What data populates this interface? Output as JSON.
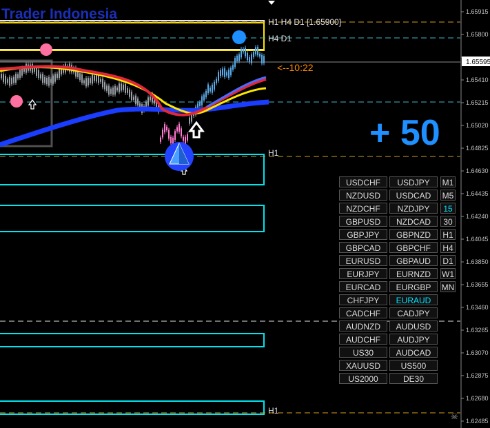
{
  "watermark": "Trader Indonesia",
  "hline_labels": {
    "h1_h4_d1": "H1 H4 D1  [1.65900]",
    "h4_d1": "H4 D1",
    "h1_upper": "H1",
    "h1_lower": "H1"
  },
  "countdown": "<--10:22",
  "profit_text": "+ 50",
  "current_price": "1.65595",
  "price_axis": [
    "1.65915",
    "1.65800",
    "1.65595",
    "1.65410",
    "1.65215",
    "1.65020",
    "1.64825",
    "1.64630",
    "1.64435",
    "1.64240",
    "1.64045",
    "1.63850",
    "1.63655",
    "1.63460",
    "1.63265",
    "1.63070",
    "1.62875",
    "1.62680",
    "1.62485"
  ],
  "pairs": [
    [
      "USDCHF",
      "USDJPY"
    ],
    [
      "NZDUSD",
      "USDCAD"
    ],
    [
      "NZDCHF",
      "NZDJPY"
    ],
    [
      "GBPUSD",
      "NZDCAD"
    ],
    [
      "GBPJPY",
      "GBPNZD"
    ],
    [
      "GBPCAD",
      "GBPCHF"
    ],
    [
      "EURUSD",
      "GBPAUD"
    ],
    [
      "EURJPY",
      "EURNZD"
    ],
    [
      "EURCAD",
      "EURGBP"
    ],
    [
      "CHFJPY",
      "EURAUD"
    ],
    [
      "CADCHF",
      "CADJPY"
    ],
    [
      "AUDNZD",
      "AUDUSD"
    ],
    [
      "AUDCHF",
      "AUDJPY"
    ],
    [
      "US30",
      "AUDCAD"
    ],
    [
      "XAUUSD",
      "US500"
    ],
    [
      "US2000",
      "DE30"
    ]
  ],
  "active_pair": "EURAUD",
  "timeframes": [
    "M1",
    "M5",
    "15",
    "30",
    "H1",
    "H4",
    "D1",
    "W1",
    "MN"
  ],
  "active_timeframe": "15",
  "colors": {
    "background": "#000000",
    "axis_text": "#c0c0c0",
    "zone_border": "#00e5ee",
    "level_gold": "#d4a017",
    "level_cyan": "#3fb8c8",
    "ma_red": "#e0283c",
    "ma_yellow": "#ffe600",
    "ma_blue": "#1a3dff",
    "profit": "#1e90ff",
    "countdown": "#ff8c00"
  }
}
